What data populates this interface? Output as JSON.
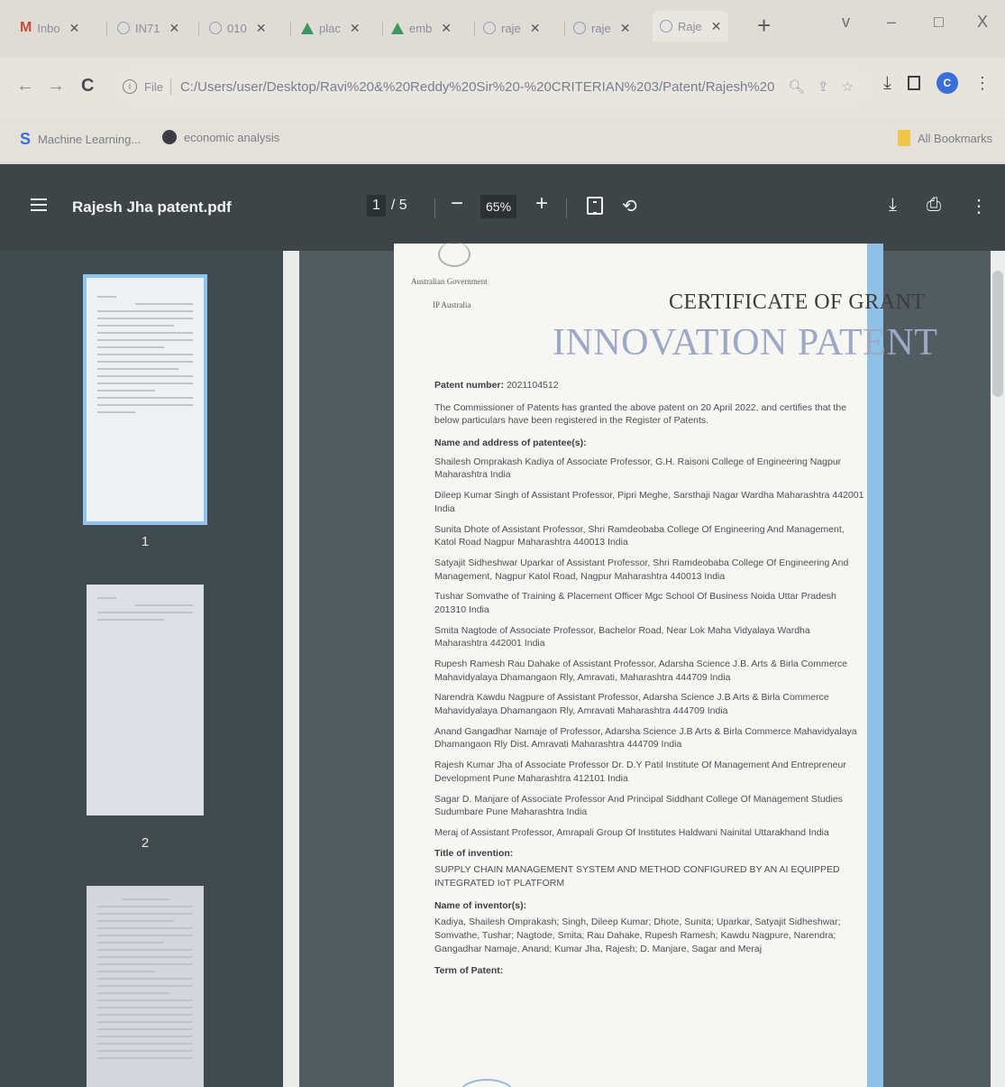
{
  "browser": {
    "tabs": [
      {
        "label": "Inbo",
        "icon": "gmail-icon"
      },
      {
        "label": "IN71",
        "icon": "globe-icon"
      },
      {
        "label": "010",
        "icon": "globe-icon"
      },
      {
        "label": "plac",
        "icon": "drive-icon"
      },
      {
        "label": "emb",
        "icon": "drive-icon"
      },
      {
        "label": "raje",
        "icon": "globe-icon"
      },
      {
        "label": "raje",
        "icon": "globe-icon"
      },
      {
        "label": "Raje",
        "icon": "globe-icon",
        "active": true
      }
    ],
    "new_tab": "+",
    "window_controls": {
      "expand": "v",
      "minimize": "–",
      "restore": "□",
      "close": "X"
    },
    "address": {
      "scheme_label": "File",
      "url": "C:/Users/user/Desktop/Ravi%20&%20Reddy%20Sir%20-%20CRITERIAN%203/Patent/Rajesh%20..."
    },
    "bookmarks": [
      {
        "label": "Machine Learning...",
        "icon": "bookmark-s-icon"
      },
      {
        "label": "economic analysis",
        "icon": "globe-icon"
      }
    ],
    "all_bookmarks": "All Bookmarks",
    "profile_initial": "C"
  },
  "pdf": {
    "filename": "Rajesh Jha patent.pdf",
    "current_page": "1",
    "page_total": "/ 5",
    "zoom": "65%",
    "thumbnails": [
      "1",
      "2"
    ]
  },
  "document": {
    "government": "Australian Government",
    "agency": "IP Australia",
    "certificate": "CERTIFICATE OF GRANT",
    "kind": "INNOVATION PATENT",
    "patent_number_label": "Patent number:",
    "patent_number": "2021104512",
    "grant_statement": "The Commissioner of Patents has granted the above patent on 20 April 2022, and certifies that the below particulars have been registered in the Register of Patents.",
    "patentees_label": "Name and address of patentee(s):",
    "patentees": [
      "Shailesh Omprakash  Kadiya of Associate Professor, G.H. Raisoni College of Engineering Nagpur Maharashtra India",
      "Dileep Kumar  Singh of Assistant Professor, Pipri Meghe, Sarsthaji Nagar Wardha Maharashtra 442001 India",
      "Sunita  Dhote of Assistant Professor, Shri Ramdeobaba College Of Engineering  And Management, Katol Road Nagpur Maharashtra 440013 India",
      "Satyajit Sidheshwar  Uparkar of Assistant Professor, Shri Ramdeobaba College Of Engineering  And Management, Nagpur Katol Road, Nagpur Maharashtra 440013 India",
      "Tushar  Somvathe of Training & Placement Officer Mgc School  Of Business Noida Uttar Pradesh 201310 India",
      "Smita  Nagtode of Associate Professor, Bachelor Road, Near Lok Maha  Vidyalaya Wardha Maharashtra 442001 India",
      "Rupesh Ramesh  Rau Dahake of Assistant Professor, Adarsha Science J.B. Arts & Birla  Commerce Mahavidyalaya Dhamangaon Rly, Amravati, Maharashtra 444709 India",
      "Narendra  Kawdu Nagpure of Assistant Professor, Adarsha Science J.B Arts & Birla  Commerce Mahavidyalaya Dhamangaon Rly, Amravati Maharashtra 444709 India",
      "Anand  Gangadhar Namaje of Professor, Adarsha Science  J.B Arts & Birla Commerce Mahavidyalaya Dhamangaon Rly  Dist. Amravati Maharashtra 444709 India",
      "Rajesh  Kumar Jha of Associate Professor Dr. D.Y Patil  Institute Of Management And  Entrepreneur Development Pune Maharashtra 412101 India",
      "Sagar  D. Manjare of Associate Professor And  Principal  Siddhant College Of Management Studies  Sudumbare Pune Maharashtra India",
      "Meraj of Assistant Professor, Amrapali Group Of Institutes  Haldwani Nainital Uttarakhand India"
    ],
    "title_label": "Title of invention:",
    "title": "SUPPLY CHAIN MANAGEMENT SYSTEM AND METHOD CONFIGURED BY AN AI EQUIPPED INTEGRATED IoT PLATFORM",
    "inventors_label": "Name of inventor(s):",
    "inventors": "Kadiya, Shailesh Omprakash; Singh, Dileep Kumar; Dhote, Sunita; Uparkar, Satyajit Sidheshwar; Somvathe, Tushar; Nagtode, Smita; Rau Dahake, Rupesh Ramesh; Kawdu Nagpure, Narendra; Gangadhar Namaje, Anand; Kumar Jha, Rajesh; D. Manjare, Sagar and Meraj",
    "term_label": "Term of Patent:"
  }
}
